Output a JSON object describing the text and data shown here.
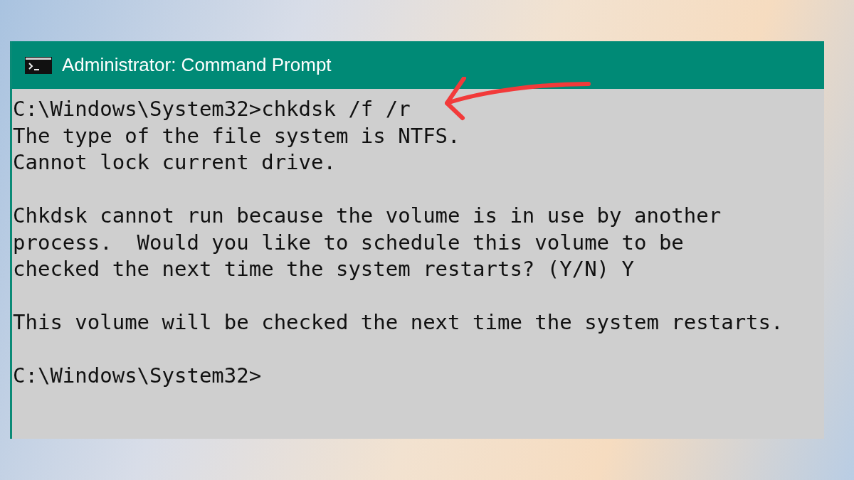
{
  "window": {
    "title": "Administrator: Command Prompt"
  },
  "console": {
    "blocks": [
      [
        "C:\\Windows\\System32>chkdsk /f /r",
        "The type of the file system is NTFS.",
        "Cannot lock current drive."
      ],
      [
        "Chkdsk cannot run because the volume is in use by another",
        "process.  Would you like to schedule this volume to be",
        "checked the next time the system restarts? (Y/N) Y"
      ],
      [
        "This volume will be checked the next time the system restarts."
      ],
      [
        "C:\\Windows\\System32>"
      ]
    ]
  }
}
